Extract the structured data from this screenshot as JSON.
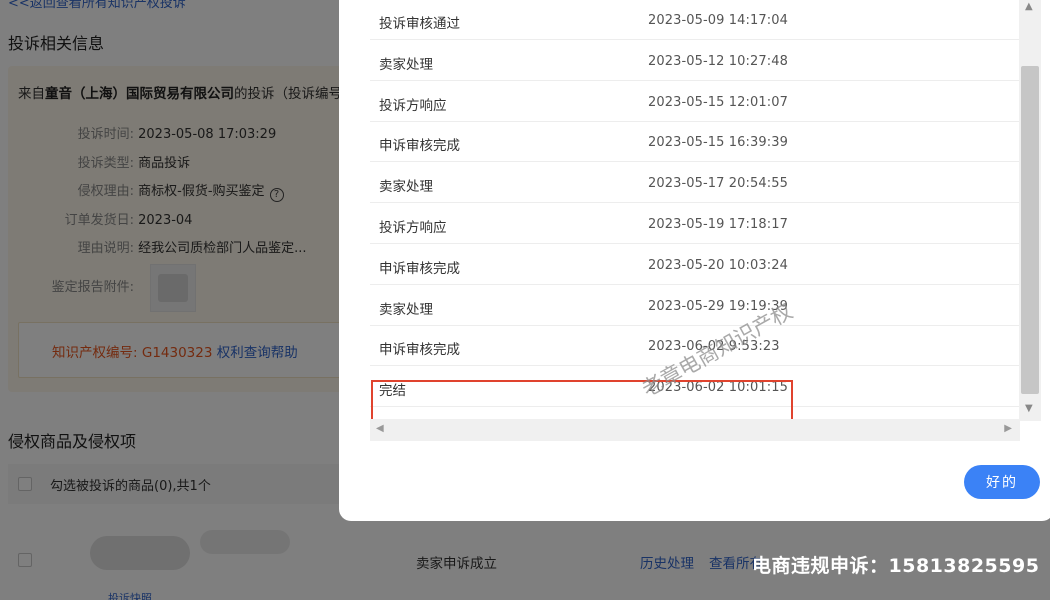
{
  "background": {
    "back_link": "<<返回查看所有知识产权投诉",
    "section_info_title": "投诉相关信息",
    "from_prefix": "来自",
    "from_company": "童音（上海）国际贸易有限公司",
    "from_suffix": "的投诉（投诉编号",
    "fields": [
      {
        "label": "投诉时间:",
        "value": "2023-05-08 17:03:29"
      },
      {
        "label": "投诉类型:",
        "value": "商品投诉"
      },
      {
        "label": "侵权理由:",
        "value": "商标权-假货-购买鉴定"
      },
      {
        "label": "订单发货日:",
        "value": "2023-04"
      },
      {
        "label": "理由说明:",
        "value": "经我公司质检部门人品鉴定..."
      },
      {
        "label": "鉴定报告附件:",
        "value": ""
      }
    ],
    "ip_label": "知识产权编号:",
    "ip_number": "G1430323",
    "ip_help": "权利查询帮助",
    "section_goods_title": "侵权商品及侵权项",
    "select_label": "勾选被投诉的商品(0),共1个",
    "product_status": "卖家申诉成立",
    "history_link": "历史处理",
    "view_link": "查看所有",
    "snapshot_link": "投诉快照"
  },
  "modal": {
    "rows": [
      {
        "name": "投诉审核通过",
        "time": "2023-05-09 14:17:04"
      },
      {
        "name": "卖家处理",
        "time": "2023-05-12 10:27:48"
      },
      {
        "name": "投诉方响应",
        "time": "2023-05-15 12:01:07"
      },
      {
        "name": "申诉审核完成",
        "time": "2023-05-15 16:39:39"
      },
      {
        "name": "卖家处理",
        "time": "2023-05-17 20:54:55"
      },
      {
        "name": "投诉方响应",
        "time": "2023-05-19 17:18:17"
      },
      {
        "name": "申诉审核完成",
        "time": "2023-05-20 10:03:24"
      },
      {
        "name": "卖家处理",
        "time": "2023-05-29 19:19:39"
      },
      {
        "name": "申诉审核完成",
        "time": "2023-06-02 9:53:23"
      },
      {
        "name": "完结",
        "time": "2023-06-02 10:01:15"
      }
    ],
    "ok_label": "好的"
  },
  "watermark": "老章电商知识产权",
  "promo_text": "电商违规申诉：15813825595"
}
